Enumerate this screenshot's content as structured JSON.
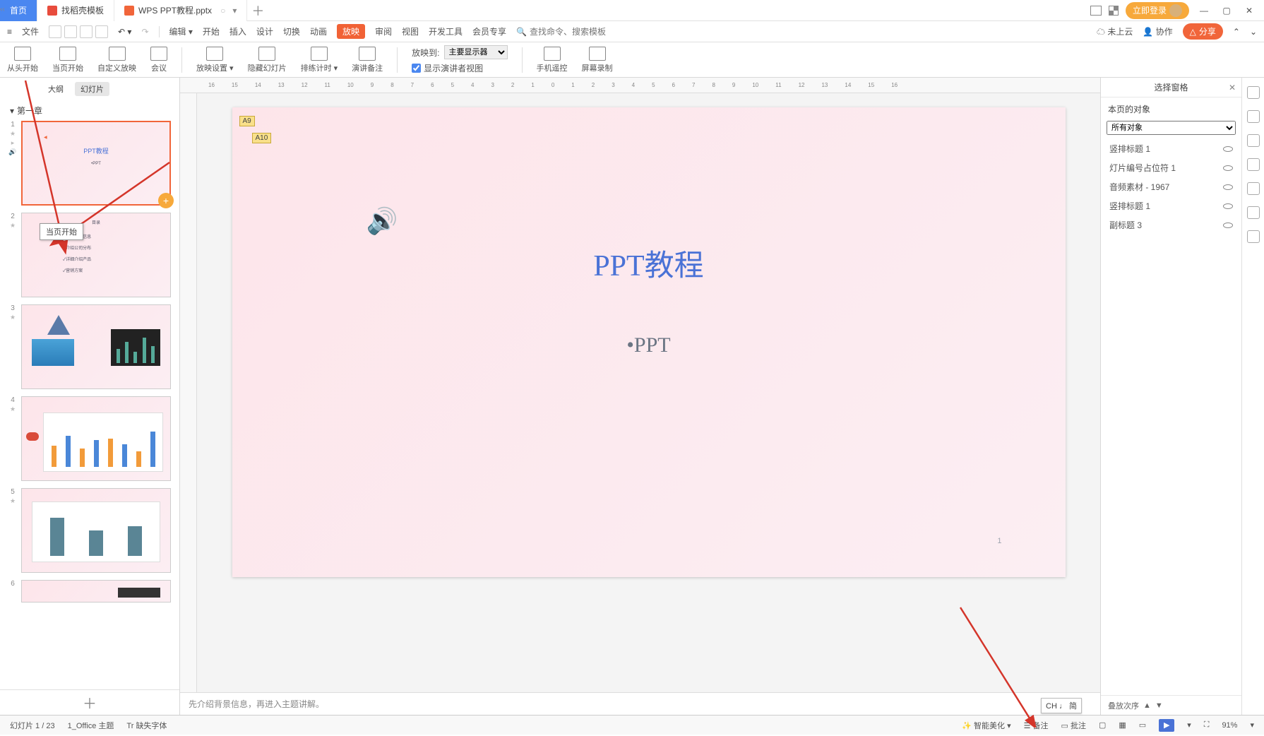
{
  "titlebar": {
    "home": "首页",
    "template": "找稻壳模板",
    "doc": "WPS PPT教程.pptx",
    "login": "立即登录"
  },
  "menubar": {
    "file": "文件",
    "items": [
      "开始",
      "插入",
      "设计",
      "切换",
      "动画",
      "放映",
      "审阅",
      "视图",
      "开发工具",
      "会员专享"
    ],
    "active": "放映",
    "search_ph": "查找命令、搜索模板",
    "cloud": "未上云",
    "coop": "协作",
    "share": "分享"
  },
  "toolbar": {
    "fromStart": "从头开始",
    "fromCurrent": "当页开始",
    "custom": "自定义放映",
    "meeting": "会议",
    "settings": "放映设置",
    "hide": "隐藏幻灯片",
    "rehearse": "排练计时",
    "notes": "演讲备注",
    "presenter": "显示演讲者视图",
    "phone": "手机遥控",
    "record": "屏幕录制",
    "displayTo": "放映到:",
    "monitor": "主要显示器"
  },
  "left": {
    "outline": "大纲",
    "slides": "幻灯片",
    "chapter": "第一章",
    "tooltip": "当页开始",
    "slide2_lines": [
      "✓介绍基本信息",
      "✓介绍公司分布",
      "✓详细介绍产品",
      "✓营销方案"
    ],
    "slide2_title": "目录"
  },
  "canvas": {
    "a9": "A9",
    "a10": "A10",
    "title": "PPT教程",
    "sub": "•PPT",
    "page": "1"
  },
  "notes": "先介绍背景信息，再进入主题讲解。",
  "rightpane": {
    "title": "选择窗格",
    "sub": "本页的对象",
    "all": "所有对象",
    "objs": [
      "竖排标题 1",
      "灯片编号占位符 1",
      "音频素材 - 1967",
      "竖排标题 1",
      "副标题 3"
    ],
    "order": "叠放次序"
  },
  "status": {
    "slide": "幻灯片 1 / 23",
    "theme": "1_Office 主题",
    "missing": "缺失字体",
    "beautify": "智能美化",
    "notes": "备注",
    "comment": "批注",
    "zoom": "91%"
  },
  "ime": "CH ♩ 简",
  "ruler": [
    "16",
    "15",
    "14",
    "13",
    "12",
    "11",
    "10",
    "9",
    "8",
    "7",
    "6",
    "5",
    "4",
    "3",
    "2",
    "1",
    "0",
    "1",
    "2",
    "3",
    "4",
    "5",
    "6",
    "7",
    "8",
    "9",
    "10",
    "11",
    "12",
    "13",
    "14",
    "15",
    "16"
  ]
}
